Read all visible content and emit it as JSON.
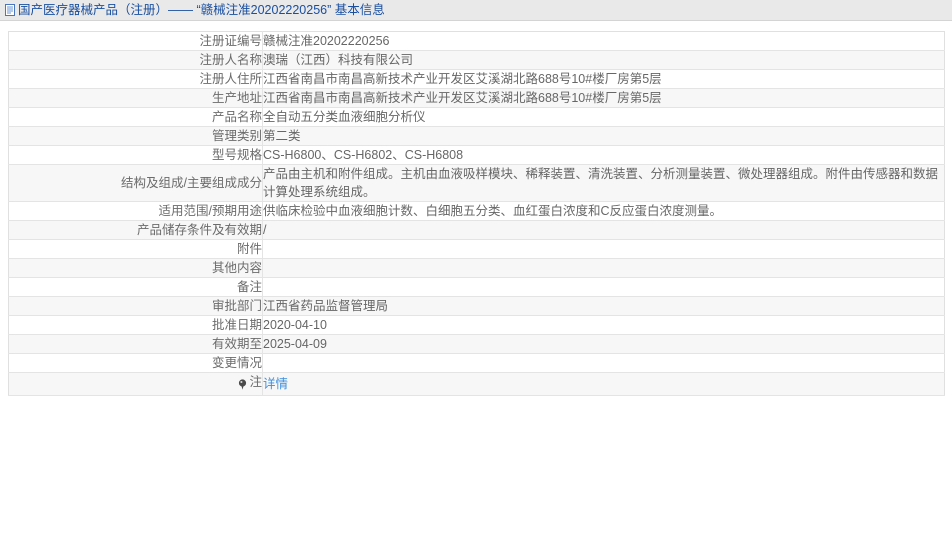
{
  "header": {
    "icon": "document-icon",
    "title": "国产医疗器械产品（注册）—— “赣械注准20202220256” 基本信息"
  },
  "table": {
    "rows": [
      {
        "label": "注册证编号",
        "value": "赣械注准20202220256"
      },
      {
        "label": "注册人名称",
        "value": "澳瑞（江西）科技有限公司"
      },
      {
        "label": "注册人住所",
        "value": "江西省南昌市南昌高新技术产业开发区艾溪湖北路688号10#楼厂房第5层"
      },
      {
        "label": "生产地址",
        "value": "江西省南昌市南昌高新技术产业开发区艾溪湖北路688号10#楼厂房第5层"
      },
      {
        "label": "产品名称",
        "value": "全自动五分类血液细胞分析仪"
      },
      {
        "label": "管理类别",
        "value": "第二类"
      },
      {
        "label": "型号规格",
        "value": "CS-H6800、CS-H6802、CS-H6808"
      },
      {
        "label": "结构及组成/主要组成成分",
        "value": "产品由主机和附件组成。主机由血液吸样模块、稀释装置、清洗装置、分析测量装置、微处理器组成。附件由传感器和数据计算处理系统组成。"
      },
      {
        "label": "适用范围/预期用途",
        "value": "供临床检验中血液细胞计数、白细胞五分类、血红蛋白浓度和C反应蛋白浓度测量。"
      },
      {
        "label": "产品储存条件及有效期",
        "value": "/"
      },
      {
        "label": "附件",
        "value": ""
      },
      {
        "label": "其他内容",
        "value": ""
      },
      {
        "label": "备注",
        "value": ""
      },
      {
        "label": "审批部门",
        "value": "江西省药品监督管理局"
      },
      {
        "label": "批准日期",
        "value": "2020-04-10"
      },
      {
        "label": "有效期至",
        "value": "2025-04-09"
      },
      {
        "label": "变更情况",
        "value": ""
      }
    ],
    "note_row": {
      "icon": "note-marker-icon",
      "label": "注",
      "link_label": "详情"
    }
  },
  "colors": {
    "header_bg": "#e9e9e9",
    "header_text": "#1a4fa0",
    "link": "#3c8ede",
    "row_alt_bg": "#f7f7f7",
    "border": "#e4e4e4",
    "text": "#666666"
  }
}
